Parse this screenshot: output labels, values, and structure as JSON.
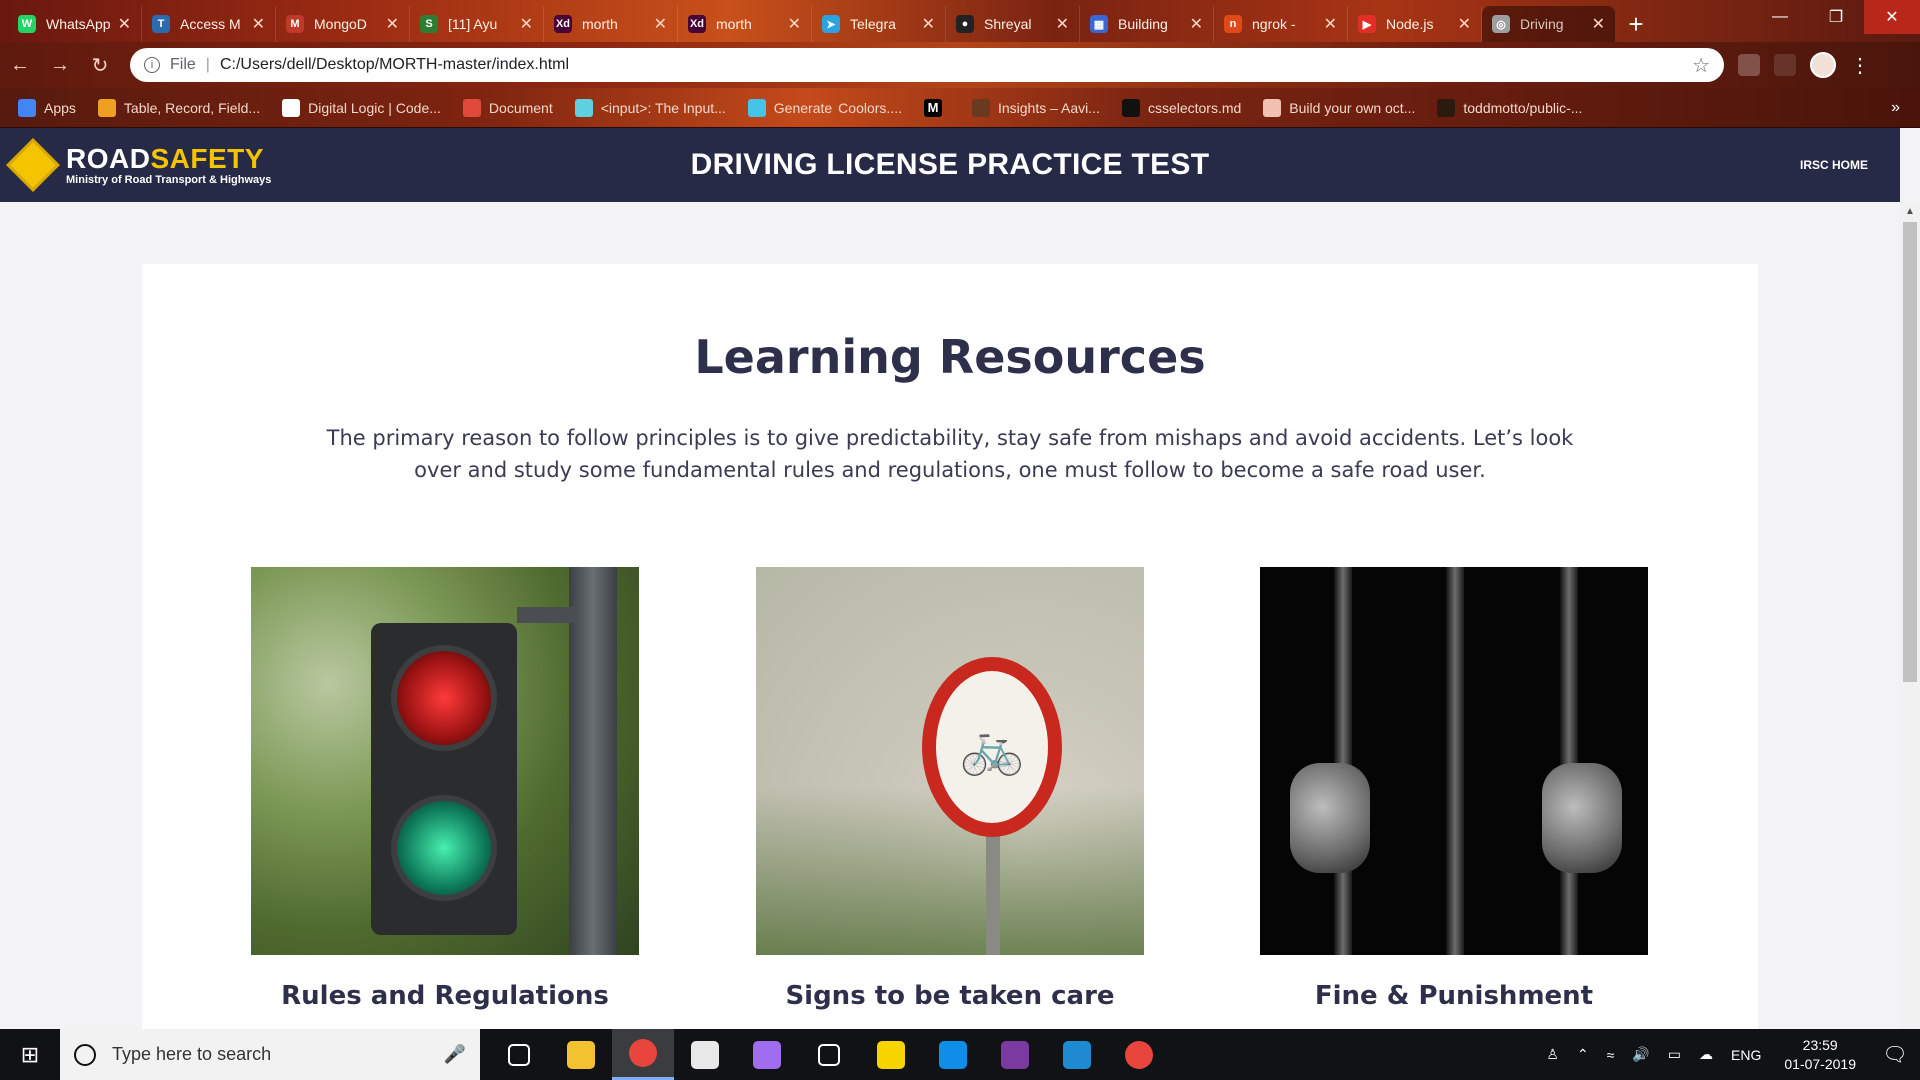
{
  "browser": {
    "tabs": [
      {
        "title": "WhatsApp",
        "favicon_color": "#25d366",
        "favicon_text": "W"
      },
      {
        "title": "Access M",
        "favicon_color": "#2b6cb0",
        "favicon_text": "T"
      },
      {
        "title": "MongoD",
        "favicon_color": "#c0392b",
        "favicon_text": "M"
      },
      {
        "title": "[11] Ayu",
        "favicon_color": "#2e7d32",
        "favicon_text": "S"
      },
      {
        "title": "morth",
        "favicon_color": "#470137",
        "favicon_text": "Xd"
      },
      {
        "title": "morth",
        "favicon_color": "#470137",
        "favicon_text": "Xd"
      },
      {
        "title": "Telegra",
        "favicon_color": "#2aa3e0",
        "favicon_text": "➤"
      },
      {
        "title": "Shreyal",
        "favicon_color": "#222222",
        "favicon_text": "●"
      },
      {
        "title": "Building",
        "favicon_color": "#3a67d6",
        "favicon_text": "▦"
      },
      {
        "title": "ngrok -",
        "favicon_color": "#e04a1a",
        "favicon_text": "n"
      },
      {
        "title": "Node.js",
        "favicon_color": "#e52d27",
        "favicon_text": "▶"
      },
      {
        "title": "Driving",
        "favicon_color": "#9e9e9e",
        "favicon_text": "◎",
        "active": true
      }
    ],
    "new_tab": "+",
    "window_controls": {
      "minimize": "—",
      "restore": "❐",
      "close": "✕"
    },
    "url_scheme": "File",
    "url": "C:/Users/dell/Desktop/MORTH-master/index.html",
    "bookmarks": [
      {
        "label": "Apps",
        "color": "#4285f4"
      },
      {
        "label": "Table, Record, Field...",
        "color": "#f0a020"
      },
      {
        "label": "Digital Logic | Code...",
        "color": "#ffffff"
      },
      {
        "label": "Document",
        "color": "#e04a3a"
      },
      {
        "label": "<input>: The Input...",
        "color": "#5fd0e0"
      },
      {
        "label": "Coolors....",
        "color": "#46c3e8",
        "prefix": "Generate"
      },
      {
        "label": "",
        "color": "#000000",
        "glyph": "M"
      },
      {
        "label": "Insights – Aavi...",
        "color": "#6a3a20"
      },
      {
        "label": "csselectors.md",
        "color": "#111111"
      },
      {
        "label": "Build your own oct...",
        "color": "#f0c0b0"
      },
      {
        "label": "toddmotto/public-...",
        "color": "#2a1a10"
      }
    ],
    "bookmarks_more": "»"
  },
  "site": {
    "logo_word_1": "ROAD",
    "logo_word_2": "SAFETY",
    "logo_sub": "Ministry of Road Transport & Highways",
    "title": "DRIVING LICENSE PRACTICE TEST",
    "nav_home": "IRSC HOME"
  },
  "main": {
    "heading": "Learning Resources",
    "intro": "The primary reason to follow principles is to give predictability, stay safe from mishaps and avoid accidents. Let’s look over and study some fundamental rules and regulations, one must follow to become a safe road user.",
    "resources": [
      {
        "label": "Rules and Regulations",
        "image": "traffic-light-photo"
      },
      {
        "label": "Signs to be taken care",
        "image": "no-cycle-sign-photo"
      },
      {
        "label": "Fine & Punishment",
        "image": "jail-bars-photo"
      }
    ]
  },
  "taskbar": {
    "search_placeholder": "Type here to search",
    "apps": [
      "task-view",
      "file-explorer",
      "chrome",
      "mail",
      "paint-3d",
      "3d-viewer",
      "sticky-notes",
      "teamviewer",
      "winrar",
      "vs-code",
      "chrome"
    ],
    "language": "ENG",
    "time": "23:59",
    "date": "01-07-2019"
  }
}
